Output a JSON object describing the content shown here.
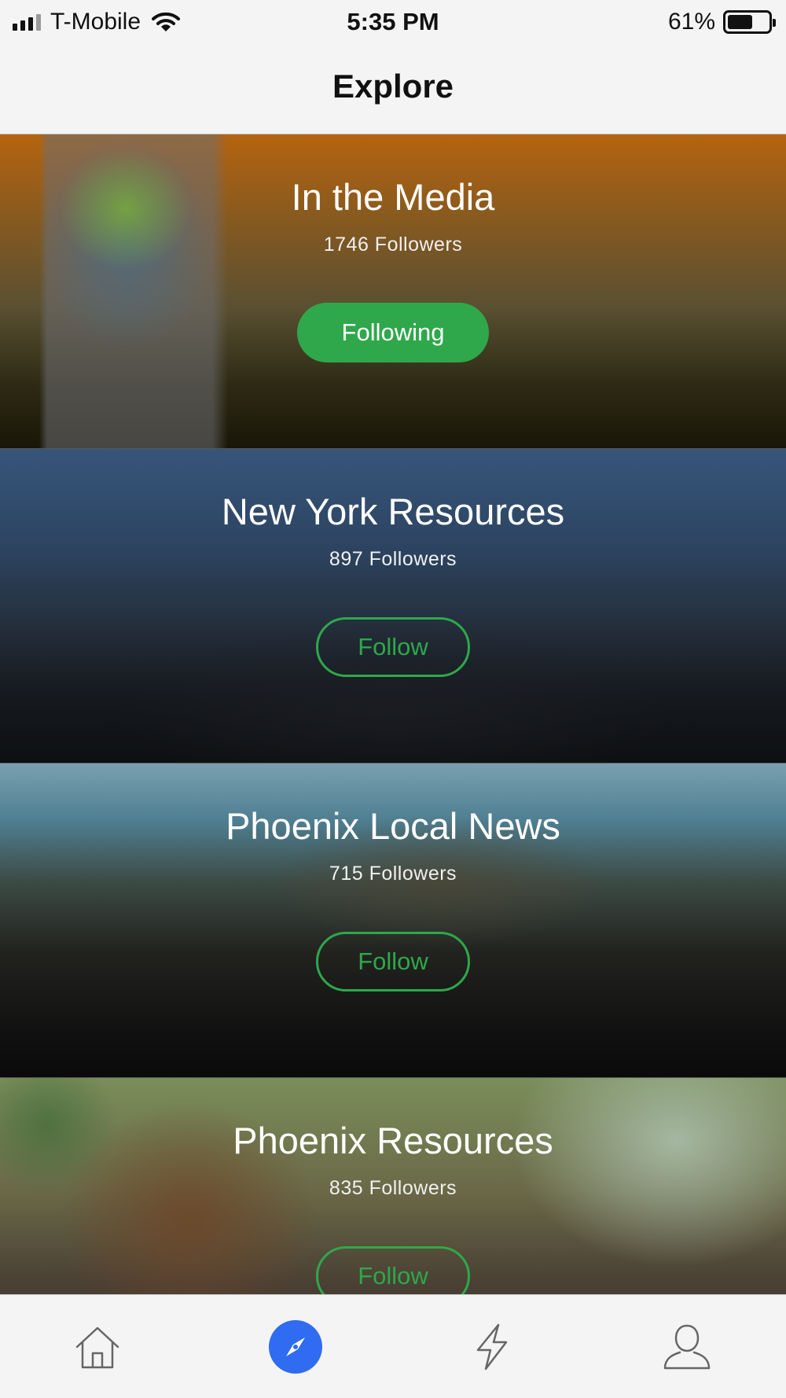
{
  "status_bar": {
    "carrier": "T-Mobile",
    "time": "5:35 PM",
    "battery_percent": "61%",
    "battery_level": 0.61,
    "signal_bars": 3
  },
  "header": {
    "title": "Explore"
  },
  "colors": {
    "accent_green": "#2ea84a",
    "tab_active_blue": "#2f6cf2"
  },
  "cards": [
    {
      "title": "In the Media",
      "followers": "1746 Followers",
      "button_label": "Following",
      "following": true
    },
    {
      "title": "New York Resources",
      "followers": "897 Followers",
      "button_label": "Follow",
      "following": false
    },
    {
      "title": "Phoenix Local News",
      "followers": "715 Followers",
      "button_label": "Follow",
      "following": false
    },
    {
      "title": "Phoenix Resources",
      "followers": "835 Followers",
      "button_label": "Follow",
      "following": false
    }
  ],
  "tab_bar": {
    "tabs": [
      {
        "icon": "home-icon",
        "active": false
      },
      {
        "icon": "compass-icon",
        "active": true
      },
      {
        "icon": "lightning-icon",
        "active": false
      },
      {
        "icon": "profile-icon",
        "active": false
      }
    ]
  }
}
